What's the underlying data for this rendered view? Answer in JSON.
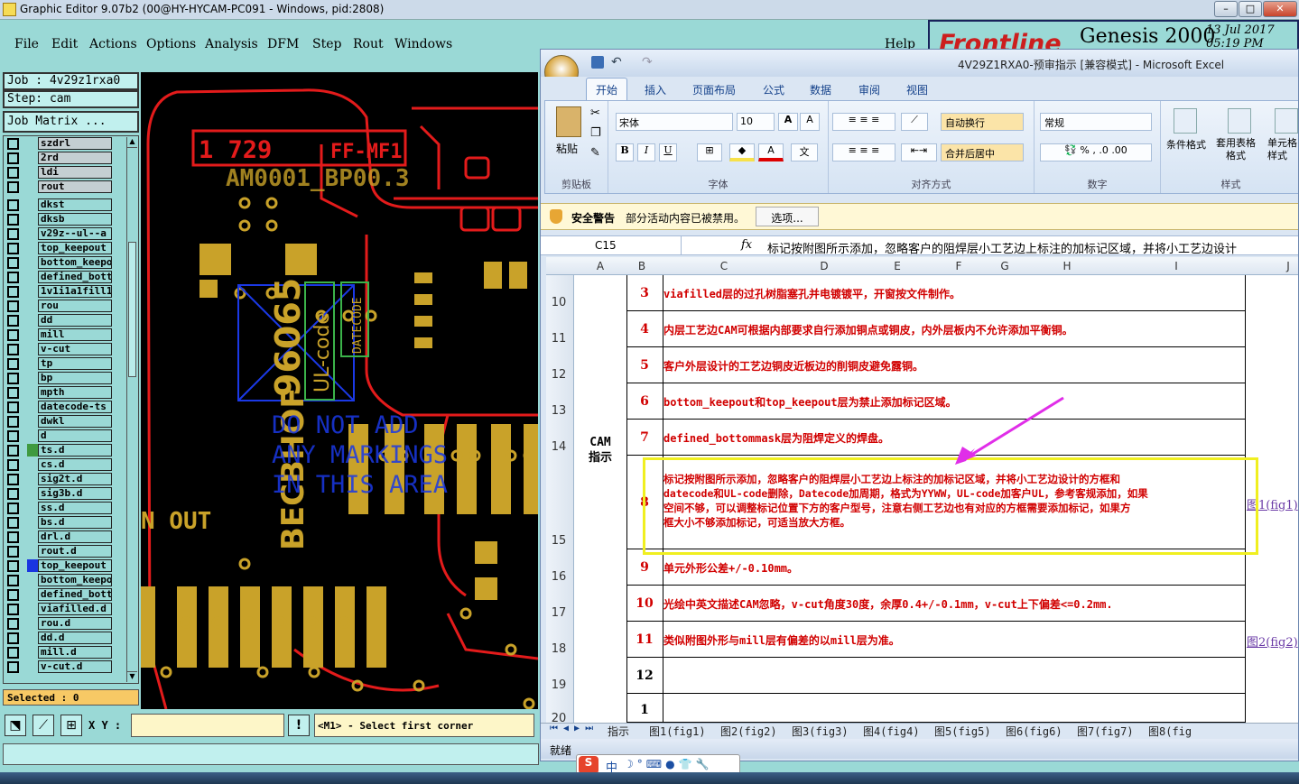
{
  "genesis": {
    "window_title": "Graphic Editor 9.07b2 (00@HY-HYCAM-PC091 - Windows, pid:2808)",
    "menu": [
      "File",
      "Edit",
      "Actions",
      "Options",
      "Analysis",
      "DFM",
      "Step",
      "Rout",
      "Windows"
    ],
    "help": "Help",
    "brand": "Frontline",
    "product": "Genesis 2000",
    "date": "13 Jul 2017",
    "time": "05:19 PM",
    "job": "Job : 4v29z1rxa0",
    "step": "Step: cam",
    "job_matrix": "Job Matrix ...",
    "layers": [
      "szdrl",
      "2rd",
      "ldi",
      "rout",
      "dkst",
      "dksb",
      "v29z--ul--a",
      "top_keepout",
      "bottom_keepout",
      "defined_bottommask",
      "1v1i1a1fill1",
      "rou",
      "dd",
      "mill",
      "v-cut",
      "tp",
      "bp",
      "mpth",
      "datecode-ts",
      "dwkl",
      "d",
      "ts.d",
      "cs.d",
      "sig2t.d",
      "sig3b.d",
      "ss.d",
      "bs.d",
      "drl.d",
      "rout.d",
      "top_keepout",
      "bottom_keepout",
      "defined_bottommask",
      "viafilled.d",
      "rou.d",
      "dd.d",
      "mill.d",
      "v-cut.d"
    ],
    "selected": "Selected : 0",
    "xy_label": "X Y :",
    "prompt": "<M1> - Select first corner",
    "canvas": {
      "ref1": "1 729",
      "ref2": "FF-MF1",
      "part": "AM0001_BP00.3",
      "num": "96065",
      "ulcode": "UL-code",
      "datecode": "DATECODE",
      "warn": [
        "DO NOT ADD",
        "ANY MARKINGS",
        "IN THIS AREA"
      ],
      "vert": "BECBHOF",
      "out": "N  OUT"
    }
  },
  "excel": {
    "title": "4V29Z1RXA0-预审指示 [兼容模式] - Microsoft Excel",
    "tabs": [
      "开始",
      "插入",
      "页面布局",
      "公式",
      "数据",
      "审阅",
      "视图"
    ],
    "groups": {
      "clipboard": "剪贴板",
      "font": "字体",
      "align": "对齐方式",
      "number": "数字",
      "styles": "样式"
    },
    "paste": "粘贴",
    "font_name": "宋体",
    "font_size": "10",
    "wrap": "自动换行",
    "merge": "合并后居中",
    "number_format": "常规",
    "cond_format": "条件格式",
    "table_format": "套用表格格式",
    "cell_style": "单元格样式",
    "warn_title": "安全警告",
    "warn_text": "部分活动内容已被禁用。",
    "options": "选项...",
    "name_box": "C15",
    "fx": "fx",
    "formula": "标记按附图所示添加，忽略客户的阻焊层小工艺边上标注的加标记区域，并将小工艺边设计",
    "columns": [
      "A",
      "B",
      "C",
      "D",
      "E",
      "F",
      "G",
      "H",
      "I",
      "J"
    ],
    "row_numbers": [
      "10",
      "11",
      "12",
      "13",
      "14",
      "15",
      "16",
      "17",
      "18",
      "19",
      "20"
    ],
    "section": "CAM\n指示",
    "rows": [
      {
        "no": "3",
        "text": "viafilled层的过孔树脂塞孔并电镀镀平，开窗按文件制作。"
      },
      {
        "no": "4",
        "text": "内层工艺边CAM可根据内部要求自行添加铜点或铜皮，内外层板内不允许添加平衡铜。"
      },
      {
        "no": "5",
        "text": "客户外层设计的工艺边铜皮近板边的削铜皮避免露铜。"
      },
      {
        "no": "6",
        "text": "bottom_keepout和top_keepout层为禁止添加标记区域。"
      },
      {
        "no": "7",
        "text": "defined_bottommask层为阻焊定义的焊盘。"
      },
      {
        "no": "8",
        "text": "标记按附图所示添加，忽略客户的阻焊层小工艺边上标注的加标记区域，并将小工艺边设计的方框和\ndatecode和UL-code删除，Datecode加周期，格式为YYWW，UL-code加客户UL，参考客规添加，如果\n空间不够，可以调整标记位置下方的客户型号，注意右侧工艺边也有对应的方框需要添加标记，如果方\n框大小不够添加标记，可适当放大方框。",
        "link": "图1(fig1)"
      },
      {
        "no": "9",
        "text": "单元外形公差+/-0.10mm。"
      },
      {
        "no": "10",
        "text": "光绘中英文描述CAM忽略，v-cut角度30度，余厚0.4+/-0.1mm，v-cut上下偏差<=0.2mm."
      },
      {
        "no": "11",
        "text": "类似附图外形与mill层有偏差的以mill层为准。",
        "link": "图2(fig2)"
      },
      {
        "no": "12",
        "text": ""
      },
      {
        "no": "1",
        "text": ""
      }
    ],
    "sheets": [
      "指示",
      "图1(fig1)",
      "图2(fig2)",
      "图3(fig3)",
      "图4(fig4)",
      "图5(fig5)",
      "图6(fig6)",
      "图7(fig7)",
      "图8(fig"
    ],
    "status": "就绪",
    "ime": "中"
  }
}
